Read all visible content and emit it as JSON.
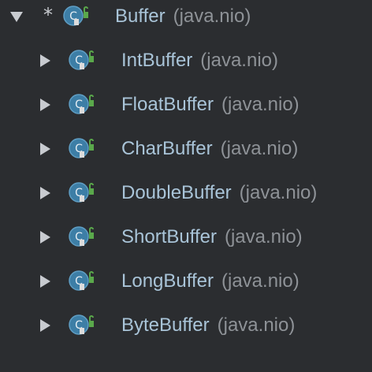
{
  "colors": {
    "background": "#2b2d30",
    "class_name": "#a9c4d8",
    "package_name": "#8e9297",
    "class_icon_fill": "#3d7ea6",
    "lock_icon": "#5aa84b",
    "arrow": "#c8cbd0"
  },
  "tree": {
    "root": {
      "marker": "*",
      "class_name": "Buffer",
      "package": "(java.nio)",
      "expanded": true,
      "icon": "class-icon",
      "access_icon": "lock-icon"
    },
    "children": [
      {
        "class_name": "IntBuffer",
        "package": "(java.nio)",
        "expanded": false,
        "icon": "class-icon",
        "access_icon": "lock-icon"
      },
      {
        "class_name": "FloatBuffer",
        "package": "(java.nio)",
        "expanded": false,
        "icon": "class-icon",
        "access_icon": "lock-icon"
      },
      {
        "class_name": "CharBuffer",
        "package": "(java.nio)",
        "expanded": false,
        "icon": "class-icon",
        "access_icon": "lock-icon"
      },
      {
        "class_name": "DoubleBuffer",
        "package": "(java.nio)",
        "expanded": false,
        "icon": "class-icon",
        "access_icon": "lock-icon"
      },
      {
        "class_name": "ShortBuffer",
        "package": "(java.nio)",
        "expanded": false,
        "icon": "class-icon",
        "access_icon": "lock-icon"
      },
      {
        "class_name": "LongBuffer",
        "package": "(java.nio)",
        "expanded": false,
        "icon": "class-icon",
        "access_icon": "lock-icon"
      },
      {
        "class_name": "ByteBuffer",
        "package": "(java.nio)",
        "expanded": false,
        "icon": "class-icon",
        "access_icon": "lock-icon"
      }
    ]
  }
}
